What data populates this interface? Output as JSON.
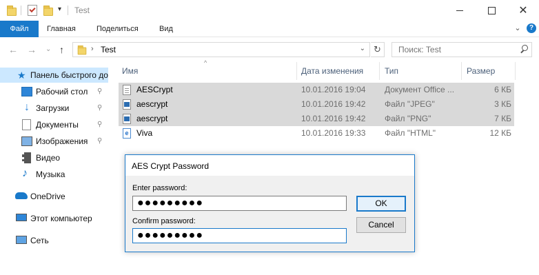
{
  "window": {
    "title": "Test",
    "controls": {
      "minimize": "minimize-icon",
      "maximize": "maximize-icon",
      "close": "✕"
    }
  },
  "ribbon": {
    "tabs": [
      "Файл",
      "Главная",
      "Поделиться",
      "Вид"
    ],
    "collapse_glyph": "⌄",
    "help_glyph": "?"
  },
  "navigation": {
    "back": "←",
    "forward": "→",
    "recent": "⌄",
    "up": "↑",
    "address": {
      "chevron": "›",
      "path": "Test",
      "dropdown": "⌄"
    },
    "refresh": "↻",
    "search": {
      "placeholder": "Поиск: Test",
      "value": ""
    }
  },
  "sidebar": {
    "items": [
      {
        "label": "Панель быстрого доступа",
        "icon": "star-icon",
        "pinned": false,
        "selected": true
      },
      {
        "label": "Рабочий стол",
        "icon": "desktop-icon",
        "pinned": true
      },
      {
        "label": "Загрузки",
        "icon": "download-icon",
        "pinned": true
      },
      {
        "label": "Документы",
        "icon": "documents-icon",
        "pinned": true
      },
      {
        "label": "Изображения",
        "icon": "pictures-icon",
        "pinned": true
      },
      {
        "label": "Видео",
        "icon": "video-icon",
        "pinned": false
      },
      {
        "label": "Музыка",
        "icon": "music-icon",
        "pinned": false
      },
      {
        "label": "OneDrive",
        "icon": "onedrive-icon",
        "pinned": false
      },
      {
        "label": "Этот компьютер",
        "icon": "computer-icon",
        "pinned": false
      },
      {
        "label": "Сеть",
        "icon": "network-icon",
        "pinned": false
      }
    ],
    "pin_glyph": "📌"
  },
  "file_list": {
    "columns": [
      "Имя",
      "Дата изменения",
      "Тип",
      "Размер"
    ],
    "sort_glyph": "^",
    "rows": [
      {
        "name": "AESCrypt",
        "date": "10.01.2016 19:04",
        "type": "Документ Office ...",
        "size": "6 КБ",
        "icon": "document-file-icon",
        "selected": true
      },
      {
        "name": "aescrypt",
        "date": "10.01.2016 19:42",
        "type": "Файл \"JPEG\"",
        "size": "3 КБ",
        "icon": "image-file-icon",
        "selected": true
      },
      {
        "name": "aescrypt",
        "date": "10.01.2016 19:42",
        "type": "Файл \"PNG\"",
        "size": "7 КБ",
        "icon": "image-file-icon",
        "selected": true
      },
      {
        "name": "Viva",
        "date": "10.01.2016 19:33",
        "type": "Файл \"HTML\"",
        "size": "12 КБ",
        "icon": "html-file-icon",
        "selected": false
      }
    ]
  },
  "dialog": {
    "title": "AES Crypt Password",
    "enter_label": "Enter password:",
    "enter_value": "●●●●●●●●●",
    "confirm_label": "Confirm password:",
    "confirm_value": "●●●●●●●●●",
    "ok_label": "OK",
    "cancel_label": "Cancel"
  },
  "colors": {
    "accent": "#1979ca",
    "selection": "#d9d9d9",
    "nav_selected": "#cce8ff",
    "header_text": "#4c607a"
  }
}
